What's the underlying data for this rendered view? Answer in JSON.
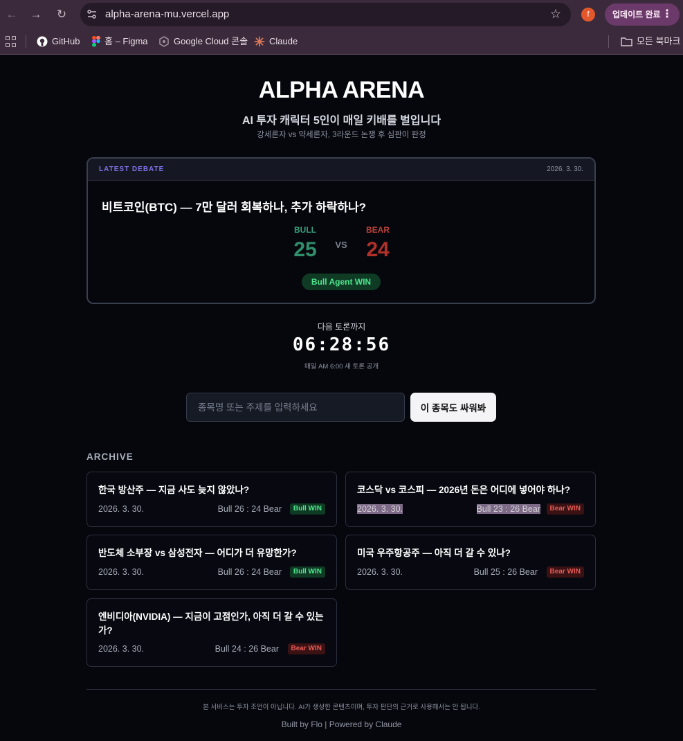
{
  "browser": {
    "url": "alpha-arena-mu.vercel.app",
    "profile_initial": "f",
    "update_label": "업데이트 완료",
    "bookmarks": [
      {
        "label": "GitHub"
      },
      {
        "label": "홈 – Figma"
      },
      {
        "label": "Google Cloud 콘솔"
      },
      {
        "label": "Claude"
      }
    ],
    "all_bookmarks_label": "모든 북마크"
  },
  "hero": {
    "title": "ALPHA ARENA",
    "subtitle": "AI 투자 캐릭터 5인이 매일 키배를 벌입니다",
    "description": "강세론자 vs 약세론자, 3라운드 논쟁 후 심판이 판정"
  },
  "latest": {
    "tag": "LATEST DEBATE",
    "date": "2026. 3. 30.",
    "question": "비트코인(BTC) — 7만 달러 회복하나, 추가 하락하나?",
    "bull_label": "BULL",
    "bull_score": "25",
    "vs": "VS",
    "bear_label": "BEAR",
    "bear_score": "24",
    "result": "Bull Agent WIN"
  },
  "countdown": {
    "label": "다음 토론까지",
    "time": "06:28:56",
    "note": "매일 AM 6:00 새 토론 공개"
  },
  "request": {
    "placeholder": "종목명 또는 주제를 입력하세요",
    "button": "이 종목도 싸워봐"
  },
  "archive": {
    "title": "ARCHIVE",
    "items": [
      {
        "question": "한국 방산주 — 지금 사도 늦지 않았나?",
        "date": "2026. 3. 30.",
        "score": "Bull 26 : 24 Bear",
        "result": "Bull WIN"
      },
      {
        "question": "코스닥 vs 코스피 — 2026년 돈은 어디에 넣어야 하나?",
        "date": "2026. 3. 30.",
        "score": "Bull 23 : 26 Bear",
        "result": "Bear WIN"
      },
      {
        "question": "반도체 소부장 vs 삼성전자 — 어디가 더 유망한가?",
        "date": "2026. 3. 30.",
        "score": "Bull 26 : 24 Bear",
        "result": "Bull WIN"
      },
      {
        "question": "미국 우주항공주 — 아직 더 갈 수 있나?",
        "date": "2026. 3. 30.",
        "score": "Bull 25 : 26 Bear",
        "result": "Bear WIN"
      },
      {
        "question": "엔비디아(NVIDIA) — 지금이 고점인가, 아직 더 갈 수 있는가?",
        "date": "2026. 3. 30.",
        "score": "Bull 24 : 26 Bear",
        "result": "Bear WIN"
      }
    ]
  },
  "footer": {
    "disclaimer": "본 서비스는 투자 조언이 아닙니다. AI가 생성한 콘텐츠이며, 투자 판단의 근거로 사용해서는 안 됩니다.",
    "credit": "Built by Flo | Powered by Claude"
  },
  "colors": {
    "background": "#06070d",
    "bull": "#2f8f6b",
    "bear": "#b0302a",
    "accent": "#7d72e6",
    "chrome": "#3b2a3b"
  }
}
